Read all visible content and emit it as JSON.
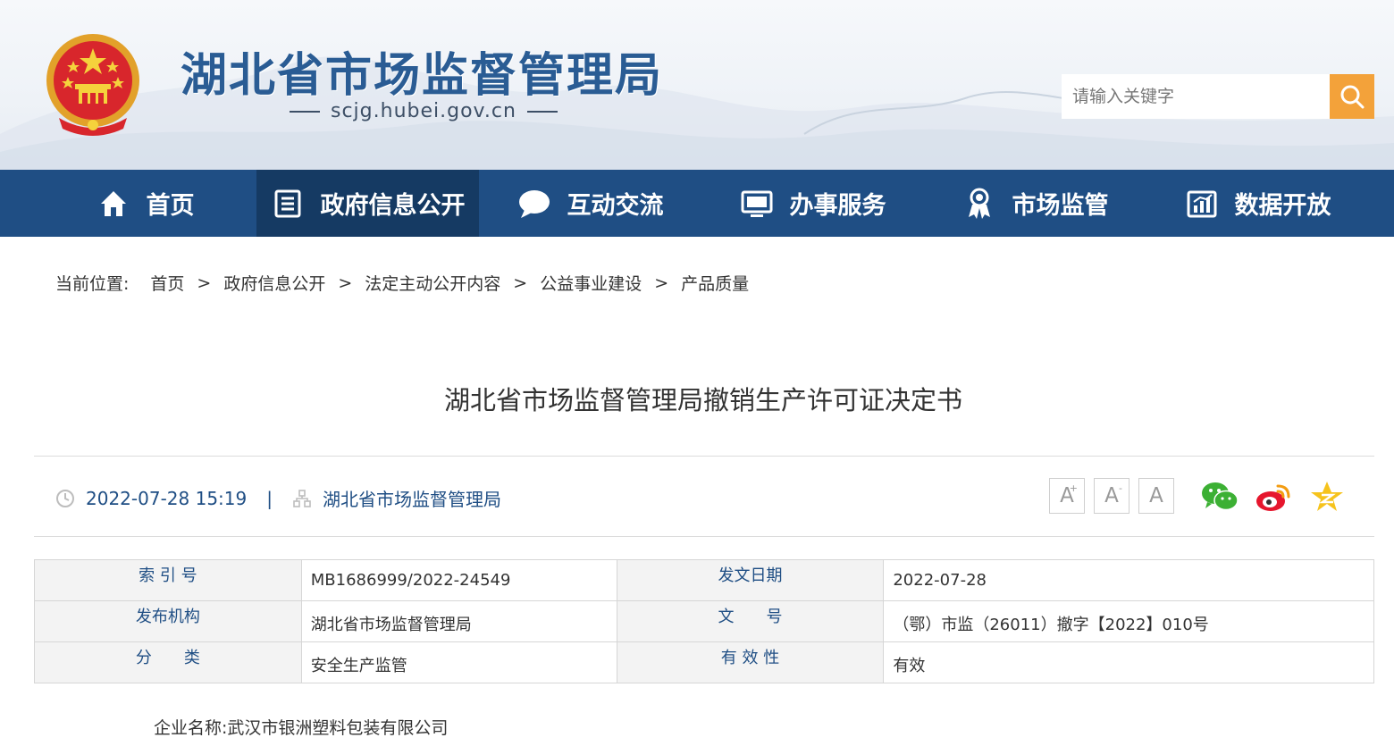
{
  "header": {
    "site_title": "湖北省市场监督管理局",
    "site_domain": "scjg.hubei.gov.cn",
    "search_placeholder": "请输入关键字"
  },
  "nav": {
    "items": [
      {
        "label": "首页",
        "icon": "home-icon"
      },
      {
        "label": "政府信息公开",
        "icon": "document-list-icon",
        "active": true
      },
      {
        "label": "互动交流",
        "icon": "chat-bubble-icon"
      },
      {
        "label": "办事服务",
        "icon": "monitor-icon"
      },
      {
        "label": "市场监管",
        "icon": "person-badge-icon"
      },
      {
        "label": "数据开放",
        "icon": "bar-chart-icon"
      }
    ]
  },
  "breadcrumb": {
    "label": "当前位置:",
    "items": [
      "首页",
      "政府信息公开",
      "法定主动公开内容",
      "公益事业建设",
      "产品质量"
    ],
    "separator": ">"
  },
  "article": {
    "title": "湖北省市场监督管理局撤销生产许可证决定书",
    "date": "2022-07-28 15:19",
    "meta_divider": "|",
    "publisher": "湖北省市场监督管理局"
  },
  "font_controls": {
    "increase": "A",
    "increase_mark": "+",
    "decrease": "A",
    "decrease_mark": "-",
    "reset": "A"
  },
  "share_icons": [
    "wechat-icon",
    "weibo-icon",
    "qzone-icon"
  ],
  "info_table": {
    "rows": [
      {
        "k1": "索 引 号",
        "v1": "MB1686999/2022-24549",
        "k2": "发文日期",
        "v2": "2022-07-28"
      },
      {
        "k1": "发布机构",
        "v1": "湖北省市场监督管理局",
        "k2": "文　　号",
        "v2": "（鄂）市监（26011）撤字【2022】010号"
      },
      {
        "k1": "分　　类",
        "v1": "安全生产监管",
        "k2": "有 效 性",
        "v2": "有效"
      }
    ]
  },
  "content": {
    "company_line": "企业名称:武汉市银洲塑料包装有限公司"
  },
  "colors": {
    "nav_bg": "#1f4e84",
    "nav_active": "#153a63",
    "search_button": "#f3a23a",
    "title_blue": "#2a5c94"
  }
}
